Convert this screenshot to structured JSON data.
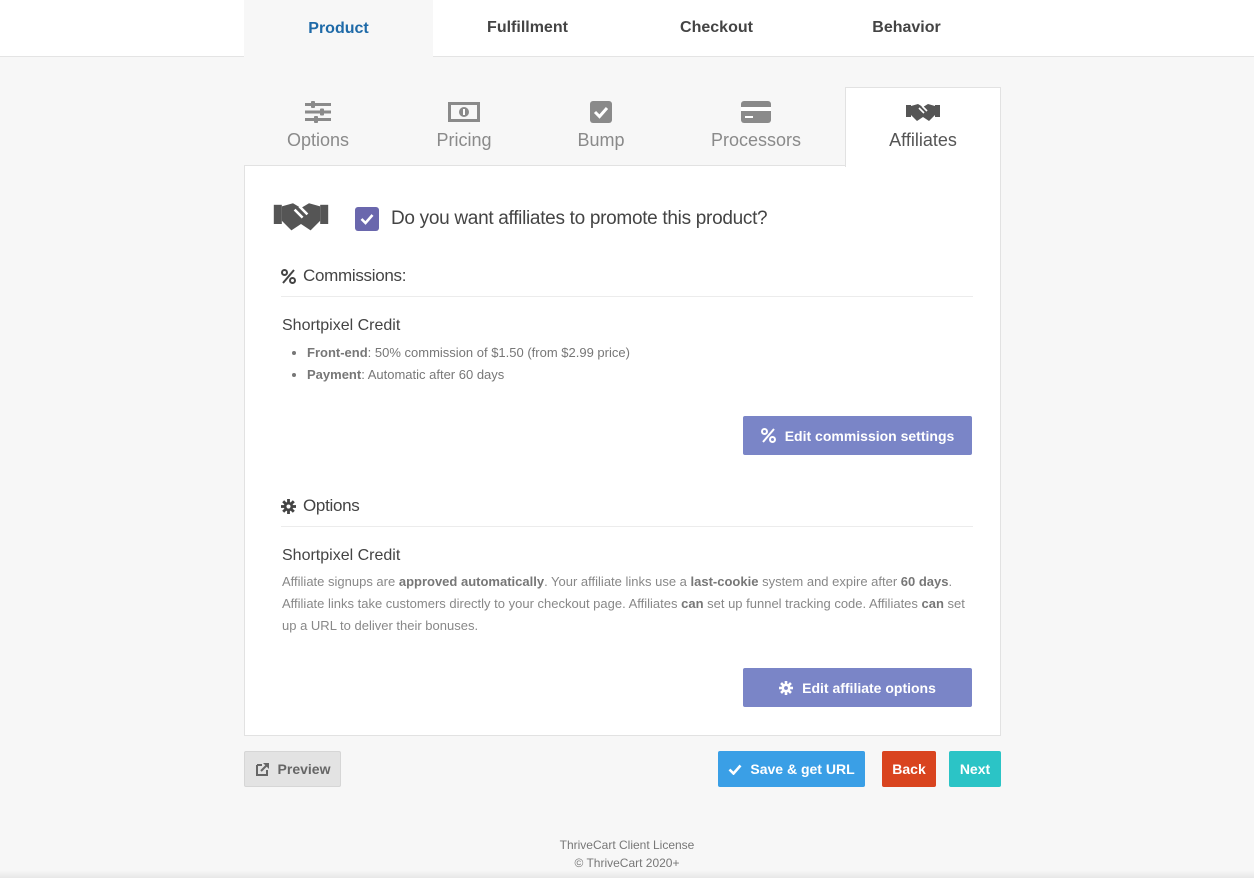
{
  "top_tabs": [
    {
      "label": "Product"
    },
    {
      "label": "Fulfillment"
    },
    {
      "label": "Checkout"
    },
    {
      "label": "Behavior"
    }
  ],
  "sub_tabs": [
    {
      "label": "Options",
      "icon": "sliders-icon"
    },
    {
      "label": "Pricing",
      "icon": "money-icon"
    },
    {
      "label": "Bump",
      "icon": "checkbox-icon"
    },
    {
      "label": "Processors",
      "icon": "credit-card-icon"
    },
    {
      "label": "Affiliates",
      "icon": "handshake-icon"
    }
  ],
  "affiliate_question": "Do you want affiliates to promote this product?",
  "commissions": {
    "heading": "Commissions:",
    "product_name": "Shortpixel Credit",
    "bullets": [
      {
        "label": "Front-end",
        "text": ": 50% commission of $1.50 (from $2.99 price)"
      },
      {
        "label": "Payment",
        "text": ": Automatic after 60 days"
      }
    ],
    "button": "Edit commission settings"
  },
  "options": {
    "heading": "Options",
    "product_name": "Shortpixel Credit",
    "desc": {
      "p1": "Affiliate signups are ",
      "b1": "approved automatically",
      "p2": ". Your affiliate links use a ",
      "b2": "last-cookie",
      "p3": " system and expire after ",
      "b3": "60 days",
      "p4": ". Affiliate links take customers directly to your checkout page. Affiliates ",
      "b4": "can",
      "p5": " set up funnel tracking code. Affiliates ",
      "b5": "can",
      "p6": " set up a URL to deliver their bonuses."
    },
    "button": "Edit affiliate options"
  },
  "actions": {
    "preview": "Preview",
    "save": "Save & get URL",
    "back": "Back",
    "next": "Next"
  },
  "footer": {
    "line1": "ThriveCart Client License",
    "line2": "© ThriveCart 2020+"
  },
  "colors": {
    "active_tab": "#1e6aa8",
    "checkbox": "#6a67ad",
    "purple_button": "#7a85c7",
    "save": "#3a9fe6",
    "back": "#d9441f",
    "next": "#2bc4c6"
  }
}
